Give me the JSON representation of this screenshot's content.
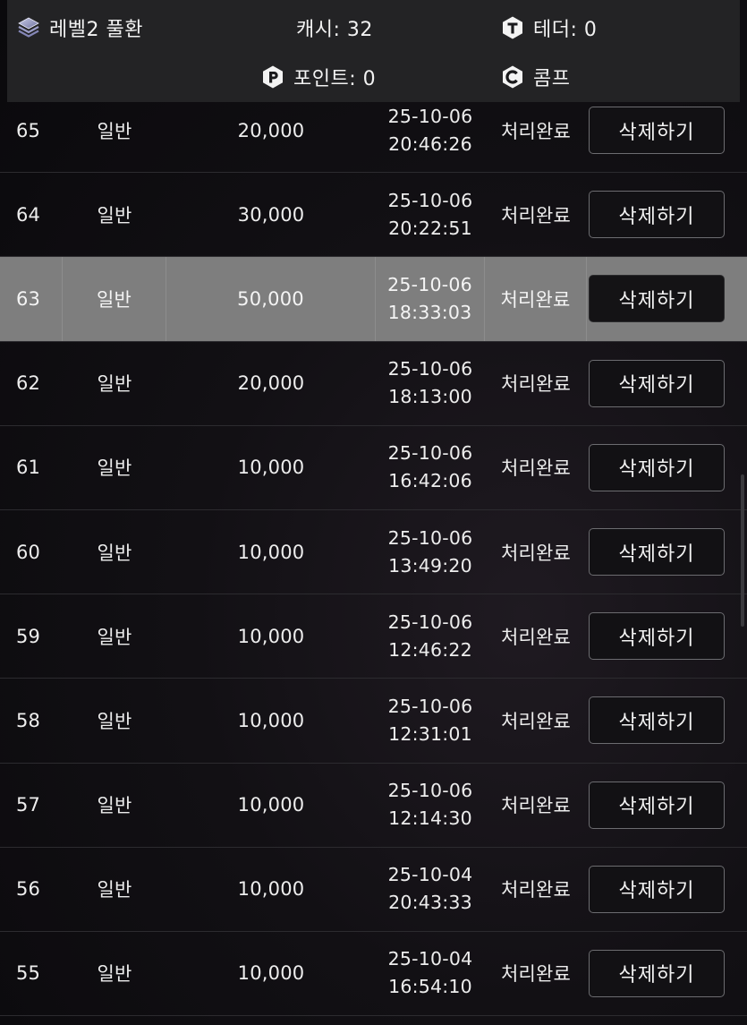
{
  "header": {
    "level_label": "레벨2 풀환",
    "cash_label": "캐시: 32",
    "tether_label": "테더: 0",
    "point_label": "포인트: 0",
    "comp_label": "콤프",
    "level_icon": "layers-icon",
    "tether_icon": "tether-T-icon",
    "point_icon": "point-P-icon",
    "comp_icon": "comp-C-icon"
  },
  "rows": [
    {
      "no": "65",
      "type": "일반",
      "amount": "20,000",
      "date": "25-10-06",
      "time": "20:46:26",
      "status": "처리완료",
      "action": "삭제하기"
    },
    {
      "no": "64",
      "type": "일반",
      "amount": "30,000",
      "date": "25-10-06",
      "time": "20:22:51",
      "status": "처리완료",
      "action": "삭제하기"
    },
    {
      "no": "63",
      "type": "일반",
      "amount": "50,000",
      "date": "25-10-06",
      "time": "18:33:03",
      "status": "처리완료",
      "action": "삭제하기"
    },
    {
      "no": "62",
      "type": "일반",
      "amount": "20,000",
      "date": "25-10-06",
      "time": "18:13:00",
      "status": "처리완료",
      "action": "삭제하기"
    },
    {
      "no": "61",
      "type": "일반",
      "amount": "10,000",
      "date": "25-10-06",
      "time": "16:42:06",
      "status": "처리완료",
      "action": "삭제하기"
    },
    {
      "no": "60",
      "type": "일반",
      "amount": "10,000",
      "date": "25-10-06",
      "time": "13:49:20",
      "status": "처리완료",
      "action": "삭제하기"
    },
    {
      "no": "59",
      "type": "일반",
      "amount": "10,000",
      "date": "25-10-06",
      "time": "12:46:22",
      "status": "처리완료",
      "action": "삭제하기"
    },
    {
      "no": "58",
      "type": "일반",
      "amount": "10,000",
      "date": "25-10-06",
      "time": "12:31:01",
      "status": "처리완료",
      "action": "삭제하기"
    },
    {
      "no": "57",
      "type": "일반",
      "amount": "10,000",
      "date": "25-10-06",
      "time": "12:14:30",
      "status": "처리완료",
      "action": "삭제하기"
    },
    {
      "no": "56",
      "type": "일반",
      "amount": "10,000",
      "date": "25-10-04",
      "time": "20:43:33",
      "status": "처리완료",
      "action": "삭제하기"
    },
    {
      "no": "55",
      "type": "일반",
      "amount": "10,000",
      "date": "25-10-04",
      "time": "16:54:10",
      "status": "처리완료",
      "action": "삭제하기"
    }
  ],
  "colors": {
    "background": "#0b0a0d",
    "header_bg": "#232325",
    "row_highlight": "#7e7e7e",
    "button_border": "#6c6c70",
    "text": "#ededed"
  }
}
